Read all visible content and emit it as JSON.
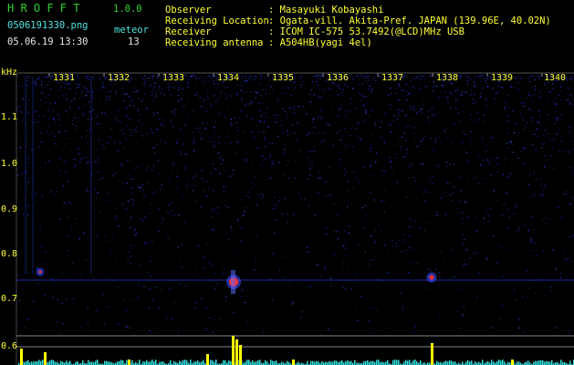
{
  "app": {
    "title": "H R O F F T",
    "version": "1.0.0",
    "filename": "0506191330.png",
    "mode": "meteor",
    "datetime": "05.06.19 13:30",
    "count": "13"
  },
  "info": {
    "observer_label": "Observer",
    "observer_value": ": Masayuki Kobayashi",
    "location_label": "Receiving Location",
    "location_value": ": Ogata-vill. Akita-Pref. JAPAN (139.96E, 40.02N)",
    "receiver_label": "Receiver",
    "receiver_value": ": ICOM IC-575 53.7492(@LCD)MHz USB",
    "antenna_label": "Receiving antenna",
    "antenna_value": ": A504HB(yagi 4el)"
  },
  "plot": {
    "freq_unit": "kHz",
    "freq_ticks": [
      "1.1",
      "1.0",
      "0.9",
      "0.8",
      "0.7",
      "0.6"
    ],
    "time_ticks": [
      "1331",
      "1332",
      "1333",
      "1334",
      "1335",
      "1336",
      "1337",
      "1338",
      "1339",
      "1340"
    ],
    "colors": {
      "text_green": "#2fd12f",
      "text_cyan": "#4fe3e3",
      "text_yellow": "#ffff33",
      "noise_blue": "#1a2bd6",
      "signal_red": "#ff3030",
      "bar_yellow": "#ffff00",
      "bar_cyan": "#33e0e0"
    }
  }
}
